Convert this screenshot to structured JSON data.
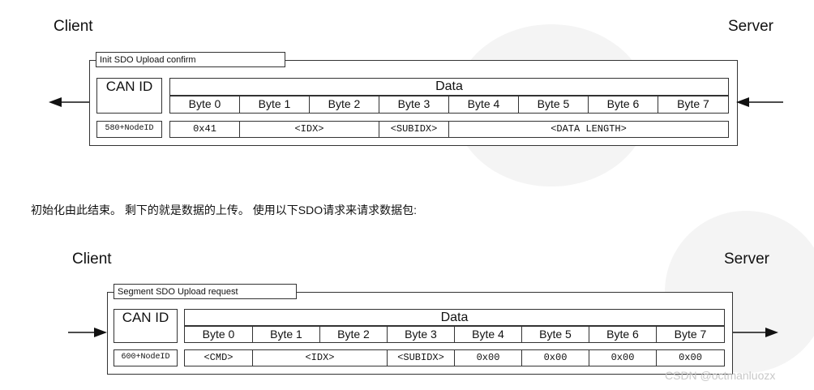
{
  "diagram1": {
    "client_label": "Client",
    "server_label": "Server",
    "frame_title": "Init SDO Upload confirm",
    "can_id_label": "CAN ID",
    "data_label": "Data",
    "bytes": [
      "Byte 0",
      "Byte 1",
      "Byte 2",
      "Byte 3",
      "Byte 4",
      "Byte 5",
      "Byte 6",
      "Byte 7"
    ],
    "node_id": "580+NodeID",
    "values": [
      "0x41",
      "<IDX>",
      "<SUBIDX>",
      "<DATA LENGTH>"
    ]
  },
  "note_text": "初始化由此结束。 剩下的就是数据的上传。 使用以下SDO请求来请求数据包:",
  "diagram2": {
    "client_label": "Client",
    "server_label": "Server",
    "frame_title": "Segment SDO Upload request",
    "can_id_label": "CAN ID",
    "data_label": "Data",
    "bytes": [
      "Byte 0",
      "Byte 1",
      "Byte 2",
      "Byte 3",
      "Byte 4",
      "Byte 5",
      "Byte 6",
      "Byte 7"
    ],
    "node_id": "600+NodeID",
    "values": [
      "<CMD>",
      "<IDX>",
      "<SUBIDX>",
      "0x00",
      "0x00",
      "0x00",
      "0x00"
    ]
  },
  "watermark": "CSDN @octmanluozx"
}
